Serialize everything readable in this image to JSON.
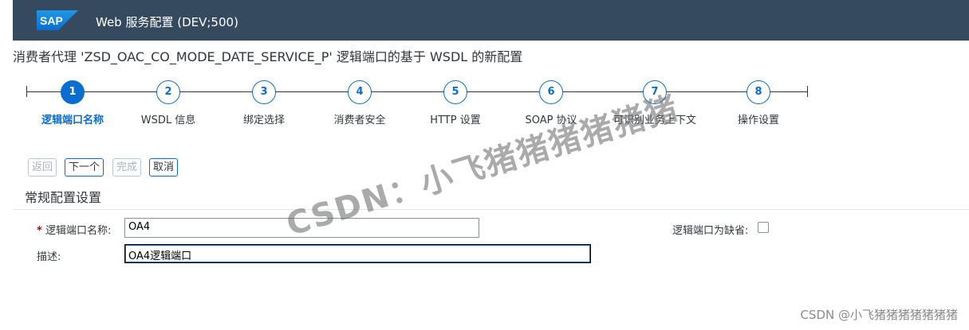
{
  "shell": {
    "logo_text": "SAP",
    "app_title": "Web 服务配置 (DEV;500)",
    "logo_color": "#0a6ed1"
  },
  "page": {
    "title": "消费者代理 'ZSD_OAC_CO_MODE_DATE_SERVICE_P' 逻辑端口的基于 WSDL 的新配置"
  },
  "wizard": {
    "current_step": 1,
    "steps": [
      {
        "number": "1",
        "label": "逻辑端口名称"
      },
      {
        "number": "2",
        "label": "WSDL 信息"
      },
      {
        "number": "3",
        "label": "绑定选择"
      },
      {
        "number": "4",
        "label": "消费者安全"
      },
      {
        "number": "5",
        "label": "HTTP 设置"
      },
      {
        "number": "6",
        "label": "SOAP 协议"
      },
      {
        "number": "7",
        "label": "可识别业务上下文"
      },
      {
        "number": "8",
        "label": "操作设置"
      }
    ]
  },
  "toolbar": {
    "back": "返回",
    "next": "下一个",
    "finish": "完成",
    "cancel": "取消"
  },
  "section": {
    "title": "常规配置设置"
  },
  "form": {
    "required_marker": "*",
    "port_name_label": "逻辑端口名称:",
    "port_name_value": "OA4",
    "description_label": "描述:",
    "description_value": "OA4逻辑端口",
    "default_label": "逻辑端口为缺省:",
    "default_checked": false
  },
  "overlay": {
    "watermark": "CSDN：小飞猪猪猪猪猪猪",
    "credit": "CSDN @小飞猪猪猪猪猪猪猪"
  },
  "colors": {
    "shell_bg": "#354a5f",
    "accent": "#0a6ed1",
    "required": "#bb0000"
  }
}
